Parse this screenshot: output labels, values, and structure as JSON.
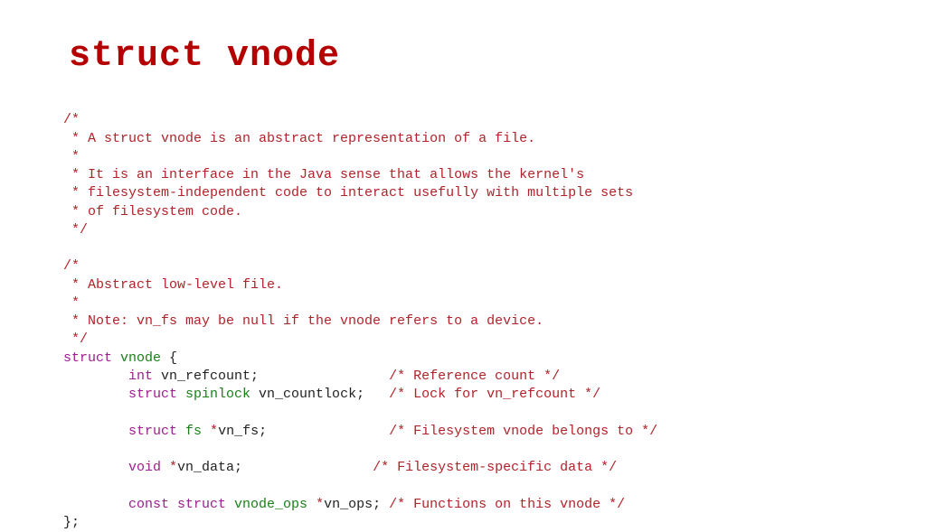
{
  "title": "struct vnode",
  "comment1": {
    "l1": "/*",
    "l2": " * A struct vnode is an abstract representation of a file.",
    "l3": " *",
    "l4": " * It is an interface in the Java sense that allows the kernel's",
    "l5": " * filesystem-independent code to interact usefully with multiple sets",
    "l6": " * of filesystem code.",
    "l7": " */"
  },
  "comment2": {
    "l1": "/*",
    "l2": " * Abstract low-level file.",
    "l3": " *",
    "l4": " * Note: vn_fs may be null if the vnode refers to a device.",
    "l5": " */"
  },
  "decl": {
    "struct_kw": "struct",
    "struct_name": "vnode",
    "open": " {",
    "close": "};",
    "indent": "        ",
    "fields": {
      "f1": {
        "t1": "int",
        "name": " vn_refcount;",
        "pad": "                ",
        "cmt": "/* Reference count */"
      },
      "f2": {
        "t1": "struct",
        "t2": " spinlock",
        "name": " vn_countlock;",
        "pad": "   ",
        "cmt": "/* Lock for vn_refcount */"
      },
      "f3": {
        "t1": "struct",
        "t2": " fs",
        "star": " *",
        "name": "vn_fs;",
        "pad": "               ",
        "cmt": "/* Filesystem vnode belongs to */"
      },
      "f4": {
        "t1": "void",
        "star": " *",
        "name": "vn_data;",
        "pad": "                ",
        "cmt": "/* Filesystem-specific data */"
      },
      "f5": {
        "t0": "const ",
        "t1": "struct",
        "t2": " vnode_ops",
        "star": " *",
        "name": "vn_ops;",
        "pad": " ",
        "cmt": "/* Functions on this vnode */"
      }
    }
  }
}
